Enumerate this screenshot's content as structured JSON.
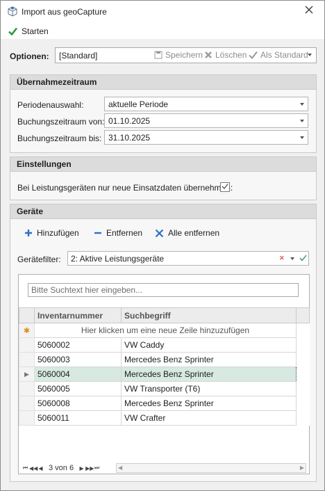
{
  "window": {
    "title": "Import aus geoCapture",
    "icon": "import-icon"
  },
  "toolbar": {
    "start_label": "Starten"
  },
  "options": {
    "label": "Optionen:",
    "value": "[Standard]",
    "save_label": "Speichern",
    "delete_label": "Löschen",
    "default_label": "Als Standard"
  },
  "period": {
    "header": "Übernahmezeitraum",
    "selection_label": "Periodenauswahl:",
    "selection_value": "aktuelle Periode",
    "from_label": "Buchungszeitraum von:",
    "from_value": "01.10.2025",
    "to_label": "Buchungszeitraum bis:",
    "to_value": "31.10.2025"
  },
  "settings": {
    "header": "Einstellungen",
    "only_new_label": "Bei Leistungsgeräten nur neue Einsatzdaten übernehmen:",
    "only_new_checked": true
  },
  "devices": {
    "header": "Geräte",
    "add_label": "Hinzufügen",
    "remove_label": "Entfernen",
    "remove_all_label": "Alle entfernen",
    "filter_label": "Gerätefilter:",
    "filter_value": "2: Aktive Leistungsgeräte",
    "search_placeholder": "Bitte Suchtext hier eingeben...",
    "columns": [
      "Inventarnummer",
      "Suchbegriff"
    ],
    "new_row_text": "Hier klicken um eine neue Zeile hinzuzufügen",
    "rows": [
      {
        "inventory": "5060002",
        "search": "VW Caddy"
      },
      {
        "inventory": "5060003",
        "search": "Mercedes Benz Sprinter"
      },
      {
        "inventory": "5060004",
        "search": "Mercedes Benz Sprinter"
      },
      {
        "inventory": "5060005",
        "search": "VW Transporter (T6)"
      },
      {
        "inventory": "5060008",
        "search": "Mercedes Benz Sprinter"
      },
      {
        "inventory": "5060011",
        "search": "VW Crafter"
      }
    ],
    "selected_row": 2,
    "pager_text": "3 von 6"
  },
  "colors": {
    "accent_green": "#2e9a3a",
    "accent_blue": "#2f6fc6",
    "selection": "#d7e9e1"
  }
}
